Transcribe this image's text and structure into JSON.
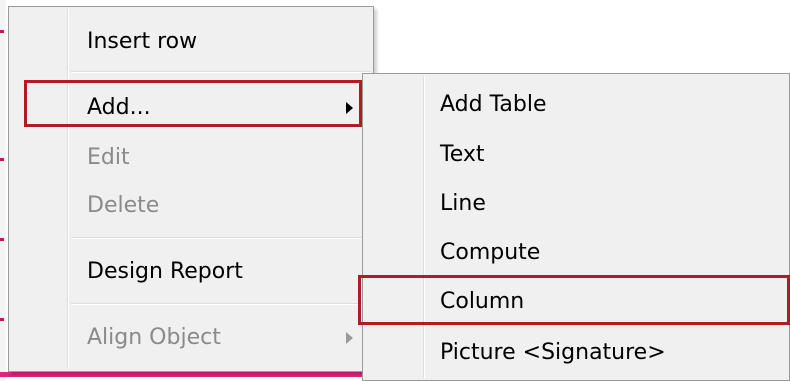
{
  "context_menu": {
    "items": [
      {
        "label": "Insert row",
        "enabled": true
      },
      {
        "label": "Add...",
        "enabled": true,
        "has_submenu": true,
        "highlighted": true
      },
      {
        "label": "Edit",
        "enabled": false
      },
      {
        "label": "Delete",
        "enabled": false
      },
      {
        "label": "Design Report",
        "enabled": true
      },
      {
        "label": "Align Object",
        "enabled": false,
        "has_submenu": true
      }
    ]
  },
  "add_submenu": {
    "items": [
      {
        "label": "Add Table"
      },
      {
        "label": "Text"
      },
      {
        "label": "Line"
      },
      {
        "label": "Compute"
      },
      {
        "label": "Column",
        "highlighted": true
      },
      {
        "label": "Picture <Signature>"
      }
    ]
  },
  "colors": {
    "highlight_border": "#b01c22",
    "accent_bar": "#e3237c",
    "disabled_text": "#8a8a8a",
    "menu_background": "#f0f0f0"
  },
  "icons": {
    "submenu_arrow": "chevron-right-icon"
  }
}
